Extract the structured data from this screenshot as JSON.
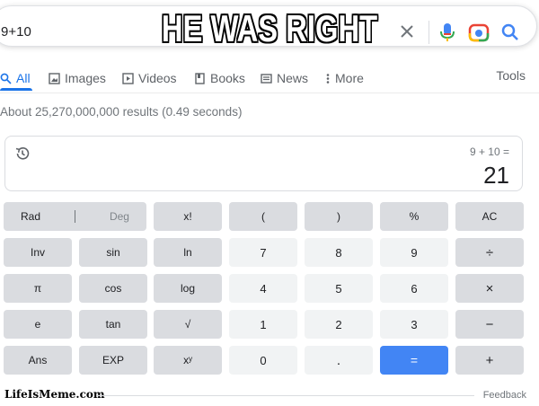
{
  "meme": {
    "caption": "HE WAS RIGHT",
    "watermark": "LifeIsMeme.com"
  },
  "search": {
    "query": "9+10",
    "icons": [
      "clear-icon",
      "mic-icon",
      "lens-icon",
      "search-icon"
    ]
  },
  "tabs": [
    {
      "label": "All",
      "icon": "search-icon",
      "active": true
    },
    {
      "label": "Images",
      "icon": "image-icon"
    },
    {
      "label": "Videos",
      "icon": "play-icon"
    },
    {
      "label": "Books",
      "icon": "book-icon"
    },
    {
      "label": "News",
      "icon": "news-icon"
    },
    {
      "label": "More",
      "icon": "kebab-icon"
    }
  ],
  "tools_label": "Tools",
  "result_stats": "About 25,270,000,000 results (0.49 seconds)",
  "calculator": {
    "expression": "9 + 10 =",
    "result": "21",
    "keys": {
      "rad": "Rad",
      "deg": "Deg",
      "fact": "x!",
      "lparen": "(",
      "rparen": ")",
      "percent": "%",
      "ac": "AC",
      "inv": "Inv",
      "sin": "sin",
      "ln": "ln",
      "seven": "7",
      "eight": "8",
      "nine": "9",
      "divide": "÷",
      "pi": "π",
      "cos": "cos",
      "log": "log",
      "four": "4",
      "five": "5",
      "six": "6",
      "multiply": "×",
      "e": "e",
      "tan": "tan",
      "sqrt": "√",
      "one": "1",
      "two": "2",
      "three": "3",
      "minus": "−",
      "ans": "Ans",
      "exp": "EXP",
      "pow": "xʸ",
      "zero": "0",
      "dot": ".",
      "equals": "=",
      "plus": "+"
    }
  },
  "footer": {
    "feedback": "Feedback"
  },
  "colors": {
    "accent": "#1a73e8",
    "equals_key": "#4285f4",
    "op_key": "#dadce0",
    "num_key": "#f1f3f4"
  }
}
